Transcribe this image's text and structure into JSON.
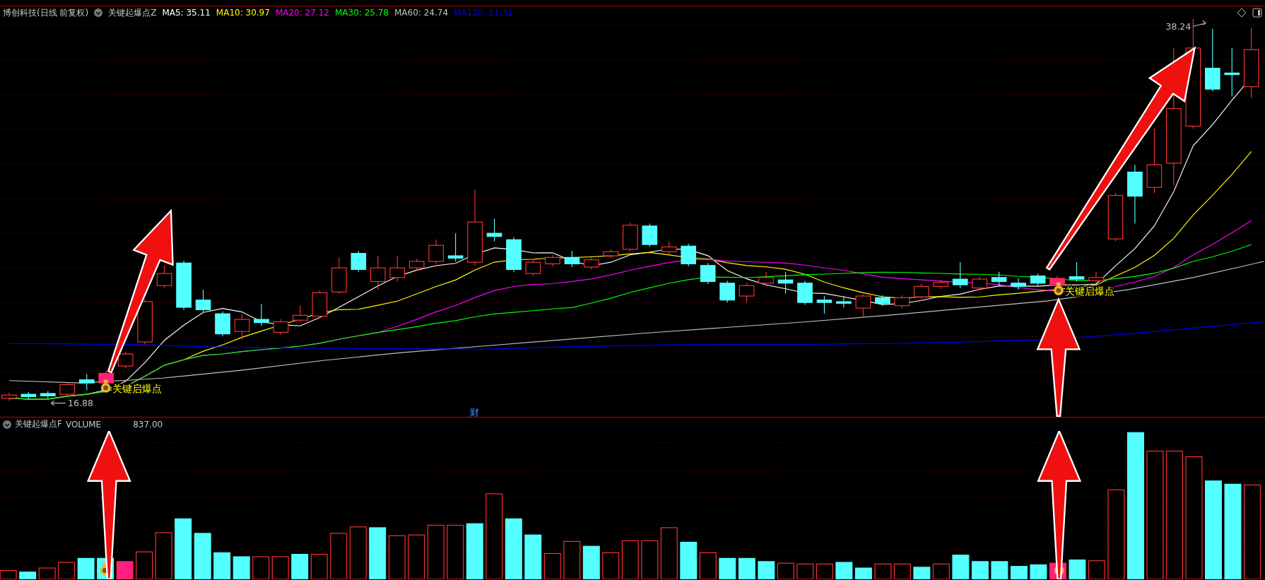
{
  "header": {
    "title": "博创科技(日线 前复权)",
    "indicator": "关键起爆点Z",
    "moving_averages": [
      {
        "label": "MA5: 35.11",
        "color": "#ffffff"
      },
      {
        "label": "MA10: 30.97",
        "color": "#ffff00"
      },
      {
        "label": "MA20: 27.12",
        "color": "#ff00ff"
      },
      {
        "label": "MA30: 25.78",
        "color": "#00ff00"
      },
      {
        "label": "MA60: 24.74",
        "color": "#c0c0c0"
      },
      {
        "label": "MA120: 21.31",
        "color": "#0000ff"
      }
    ]
  },
  "price_chart": {
    "high_label": "38.24",
    "low_label": "16.88",
    "signal_labels": [
      "关键启爆点",
      "关键启爆点"
    ],
    "event_marker": "财"
  },
  "volume_header": {
    "indicator": "关键起爆点F",
    "name": "VOLUME",
    "value": "837.00"
  }
}
